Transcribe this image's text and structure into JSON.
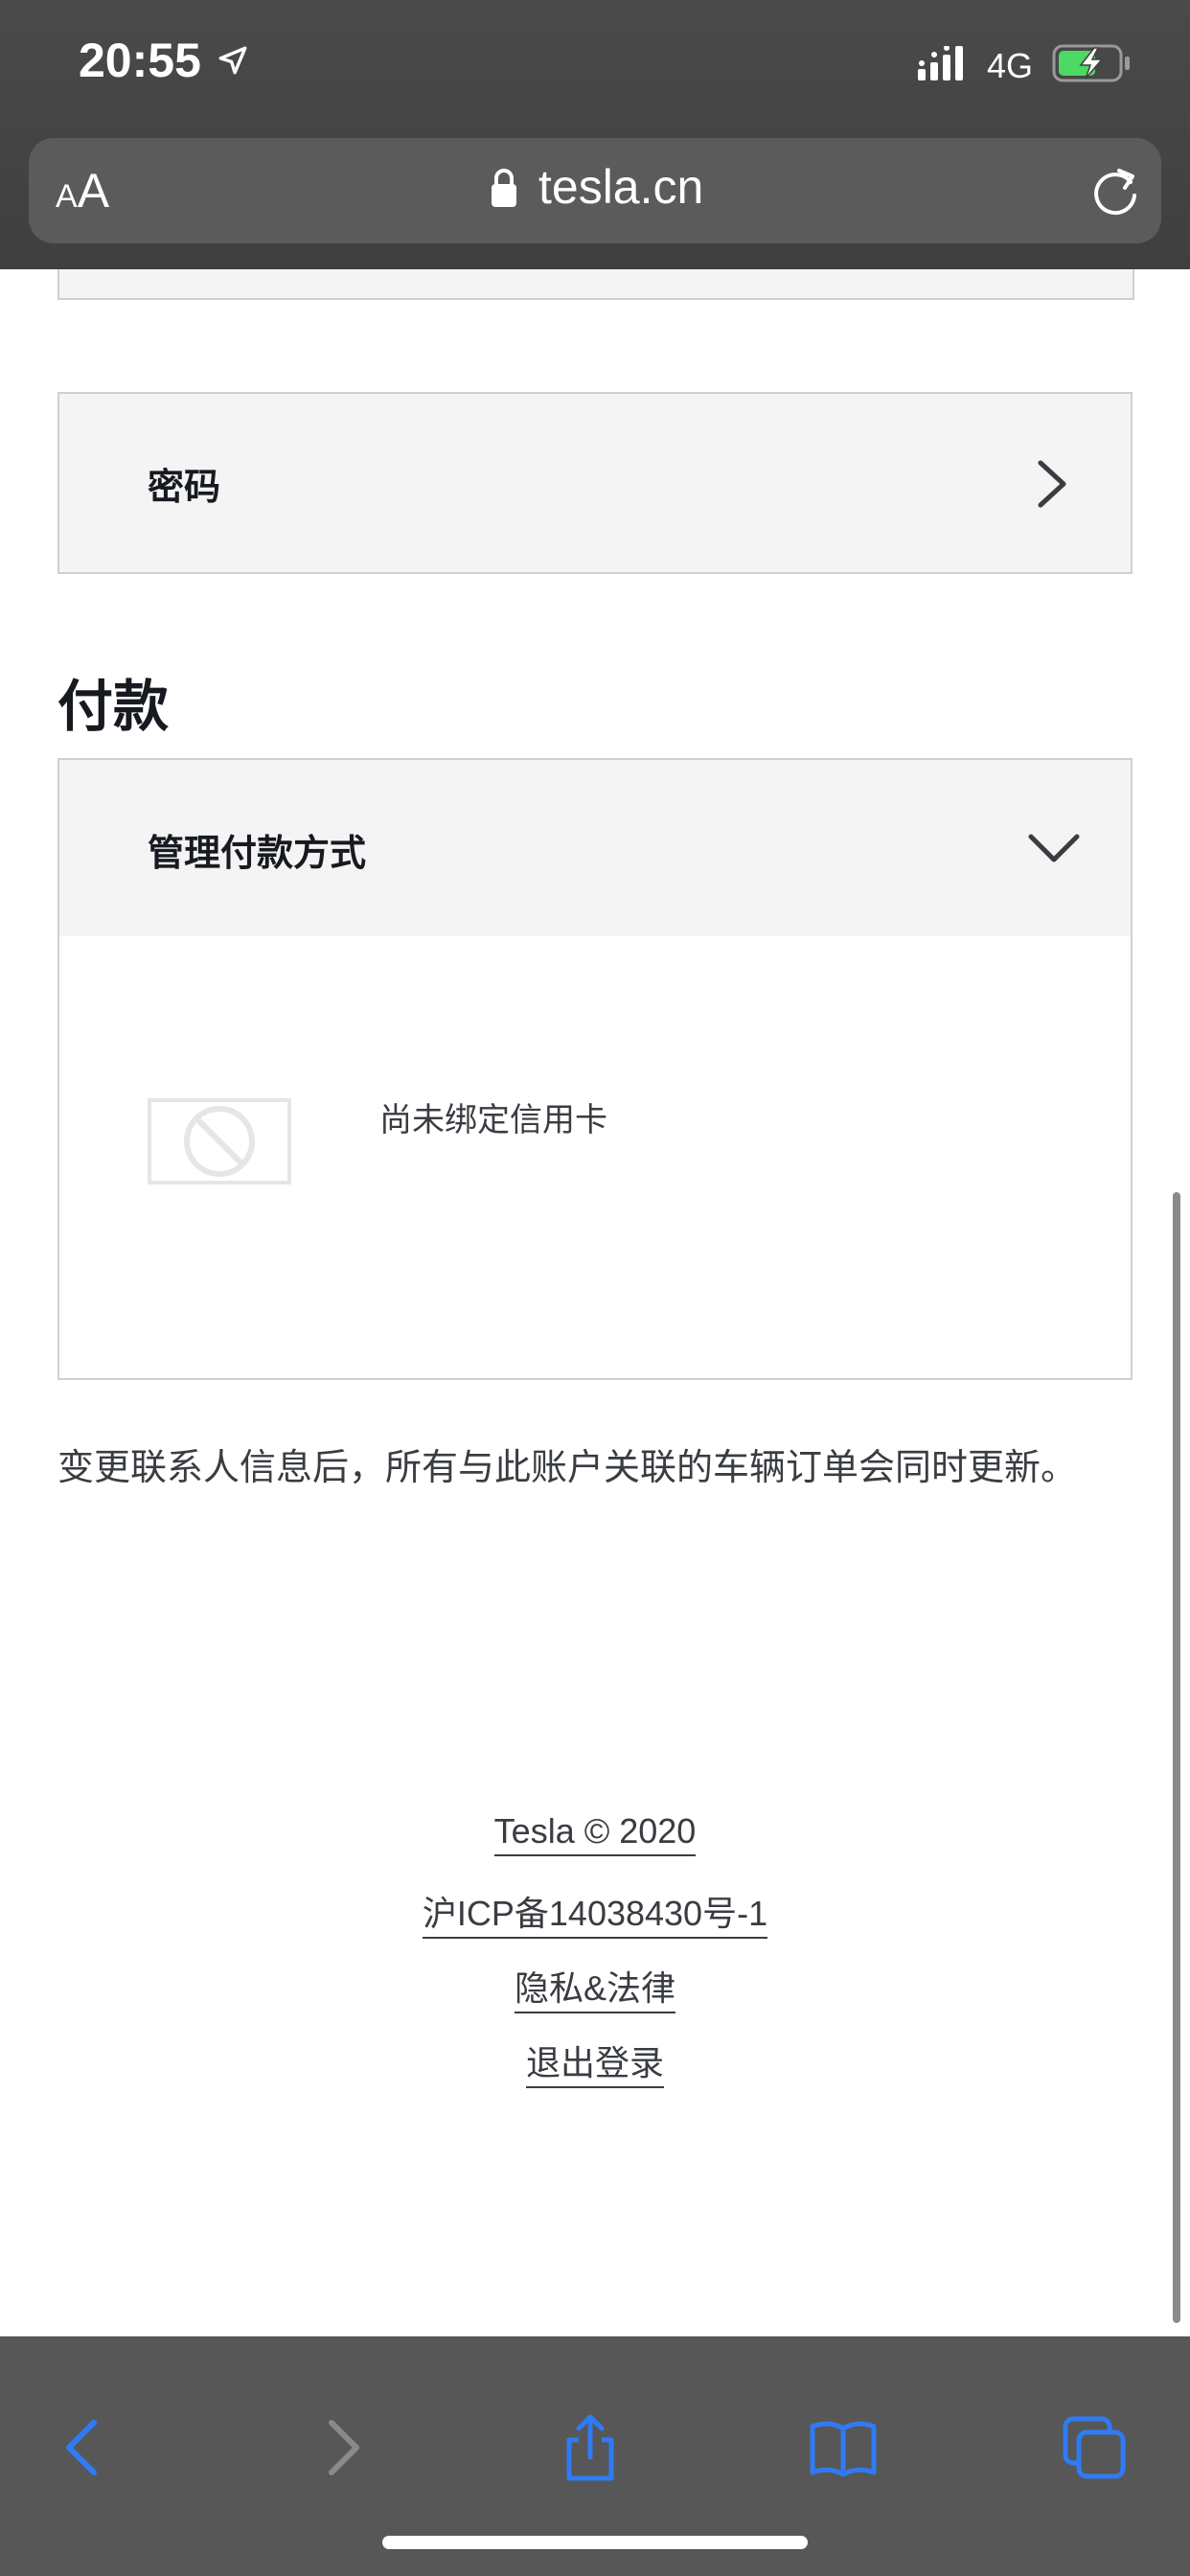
{
  "status_bar": {
    "time": "20:55",
    "network": "4G",
    "icons": [
      "location-arrow-icon",
      "signal-icon",
      "battery-charging-icon"
    ]
  },
  "browser": {
    "aa_small": "A",
    "aa_big": "A",
    "url": "tesla.cn",
    "icons": [
      "lock-icon",
      "reload-icon"
    ]
  },
  "account": {
    "password_label": "密码"
  },
  "payment": {
    "section_title": "付款",
    "manage_label": "管理付款方式",
    "no_card_text": "尚未绑定信用卡"
  },
  "note": "变更联系人信息后，所有与此账户关联的车辆订单会同时更新。",
  "footer": {
    "copyright": "Tesla © 2020",
    "icp": "沪ICP备14038430号-1",
    "privacy": "隐私&法律",
    "logout": "退出登录"
  },
  "toolbar": {
    "icons": [
      "back-icon",
      "forward-icon",
      "share-icon",
      "bookmarks-icon",
      "tabs-icon"
    ]
  },
  "colors": {
    "accent": "#2f7bf5",
    "card_bg": "#f4f4f4",
    "battery_green": "#4cd964"
  }
}
